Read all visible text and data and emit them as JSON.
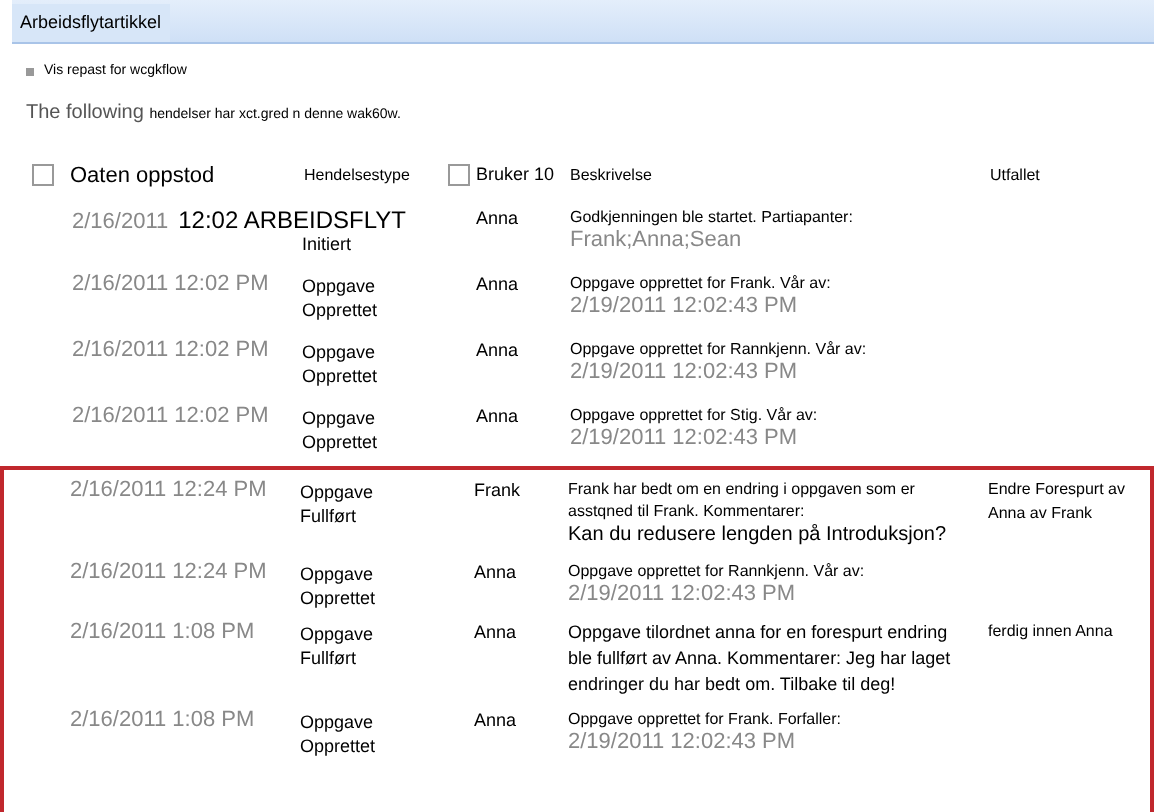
{
  "panel": {
    "title": "Arbeidsflytartikkel"
  },
  "report_link": "Vis repast for wcgkflow",
  "intro": {
    "lead": "The following",
    "rest": "hendelser har xct.gred n denne wak60w."
  },
  "columns": [
    {
      "kind": "check",
      "label": "Oaten oppstod",
      "checked": false
    },
    {
      "kind": "plain",
      "label": "Hendelsestype"
    },
    {
      "kind": "check",
      "label": "Bruker 10",
      "checked": false
    },
    {
      "kind": "plain",
      "label": "Beskrivelse"
    },
    {
      "kind": "plain",
      "label": "Utfallet"
    }
  ],
  "rows": [
    {
      "kind": "start",
      "highlighted": false,
      "date": "2/16/2011",
      "heading": "12:02 ARBEIDSFLYT",
      "type": [
        "Initiert"
      ],
      "user": "Anna",
      "description": [
        {
          "kind": "text",
          "text": "Godkjenningen ble startet. Partiapanter:"
        },
        {
          "kind": "detail",
          "text": "Frank;Anna;Sean"
        }
      ]
    },
    {
      "kind": "event",
      "highlighted": false,
      "date": "2/16/2011 12:02 PM",
      "type": [
        "Oppgave",
        "Opprettet"
      ],
      "user": "Anna",
      "description": [
        {
          "kind": "text",
          "text": "Oppgave opprettet for Frank. Vår av:"
        },
        {
          "kind": "detail",
          "text": "2/19/2011 12:02:43 PM"
        }
      ]
    },
    {
      "kind": "event",
      "highlighted": false,
      "date": "2/16/2011 12:02 PM",
      "type": [
        "Oppgave",
        "Opprettet"
      ],
      "user": "Anna",
      "description": [
        {
          "kind": "text",
          "text": "Oppgave opprettet for Rannkjenn. Vår av:"
        },
        {
          "kind": "detail",
          "text": "2/19/2011 12:02:43 PM"
        }
      ]
    },
    {
      "kind": "event",
      "highlighted": false,
      "date": "2/16/2011 12:02 PM",
      "type": [
        "Oppgave",
        "Opprettet"
      ],
      "user": "Anna",
      "description": [
        {
          "kind": "text",
          "text": "Oppgave opprettet for Stig. Vår av:"
        },
        {
          "kind": "detail",
          "text": "2/19/2011 12:02:43 PM"
        }
      ]
    },
    {
      "kind": "event",
      "highlighted": true,
      "date": "2/16/2011 12:24 PM",
      "type": [
        "Oppgave",
        "Fullført"
      ],
      "user": "Frank",
      "description": [
        {
          "kind": "text",
          "text": "Frank har bedt om en endring i oppgaven som er asstqned til Frank. Kommentarer:"
        },
        {
          "kind": "comment",
          "text": "Kan du redusere lengden på Introduksjon?"
        }
      ],
      "outcome": "Endre Forespurt av Anna av Frank"
    },
    {
      "kind": "event",
      "highlighted": true,
      "date": "2/16/2011 12:24 PM",
      "type": [
        "Oppgave",
        "Opprettet"
      ],
      "user": "Anna",
      "description": [
        {
          "kind": "text",
          "text": "Oppgave opprettet for Rannkjenn. Vår av:"
        },
        {
          "kind": "detail",
          "text": "2/19/2011 12:02:43 PM"
        }
      ]
    },
    {
      "kind": "event",
      "highlighted": true,
      "date": "2/16/2011 1:08 PM",
      "type": [
        "Oppgave",
        "Fullført"
      ],
      "user": "Anna",
      "description": [
        {
          "kind": "lead",
          "text": "Oppgave tilordnet anna for en forespurt endring ble fullført av Anna. Kommentarer: Jeg har laget endringer du har bedt om. Tilbake til deg!"
        }
      ],
      "outcome": "ferdig innen Anna"
    },
    {
      "kind": "event",
      "highlighted": true,
      "date": "2/16/2011 1:08 PM",
      "type": [
        "Oppgave",
        "Opprettet"
      ],
      "user": "Anna",
      "description": [
        {
          "kind": "text",
          "text": "Oppgave opprettet for Frank. Forfaller:"
        },
        {
          "kind": "detail",
          "text": "2/19/2011 12:02:43 PM"
        }
      ]
    }
  ]
}
